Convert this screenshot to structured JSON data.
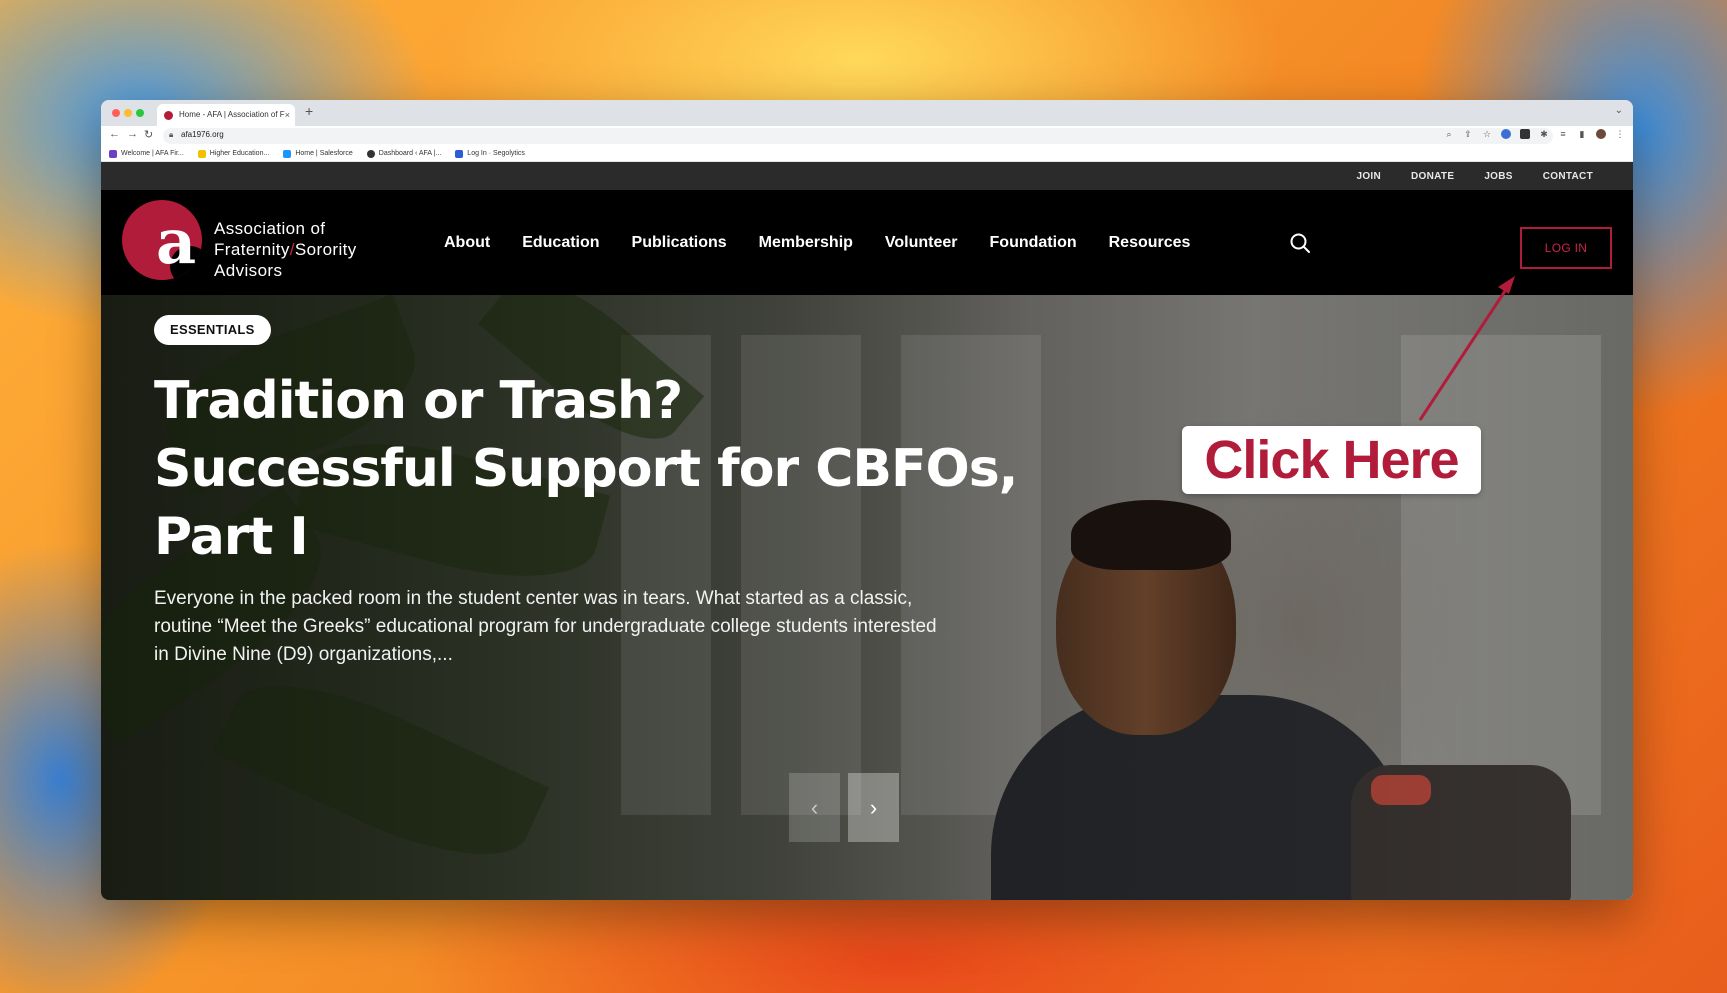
{
  "browser": {
    "tab_title": "Home - AFA | Association of F",
    "tab_close": "×",
    "new_tab": "+",
    "url": "afa1976.org",
    "bookmarks": [
      {
        "label": "Welcome | AFA Fir...",
        "color": "#6c3fc5"
      },
      {
        "label": "Higher Education...",
        "color": "#f2c100"
      },
      {
        "label": "Home | Salesforce",
        "color": "#1b96ff"
      },
      {
        "label": "Dashboard ‹ AFA |...",
        "color": "#333333"
      },
      {
        "label": "Log In · Segolytics",
        "color": "#2b5bd7"
      }
    ]
  },
  "site": {
    "util_links": [
      "JOIN",
      "DONATE",
      "JOBS",
      "CONTACT"
    ],
    "logo": {
      "letter": "a",
      "line1": "Association of",
      "line2a": "Fraternity",
      "line2slash": "/",
      "line2b": "Sorority",
      "line3": "Advisors"
    },
    "nav": [
      "About",
      "Education",
      "Publications",
      "Membership",
      "Volunteer",
      "Foundation",
      "Resources"
    ],
    "login_label": "LOG IN",
    "accent_color": "#b01c39"
  },
  "hero": {
    "badge": "ESSENTIALS",
    "headline_line1": "Tradition or Trash?",
    "headline_line2": "Successful Support for CBFOs,",
    "headline_line3": "Part I",
    "excerpt": "Everyone in the packed room in the student center was in tears. What started as a classic, routine “Meet the Greeks” educational program for undergraduate college students interested in Divine Nine (D9) organizations,...",
    "prev_icon": "‹",
    "next_icon": "›"
  },
  "annotation": {
    "callout": "Click Here"
  }
}
